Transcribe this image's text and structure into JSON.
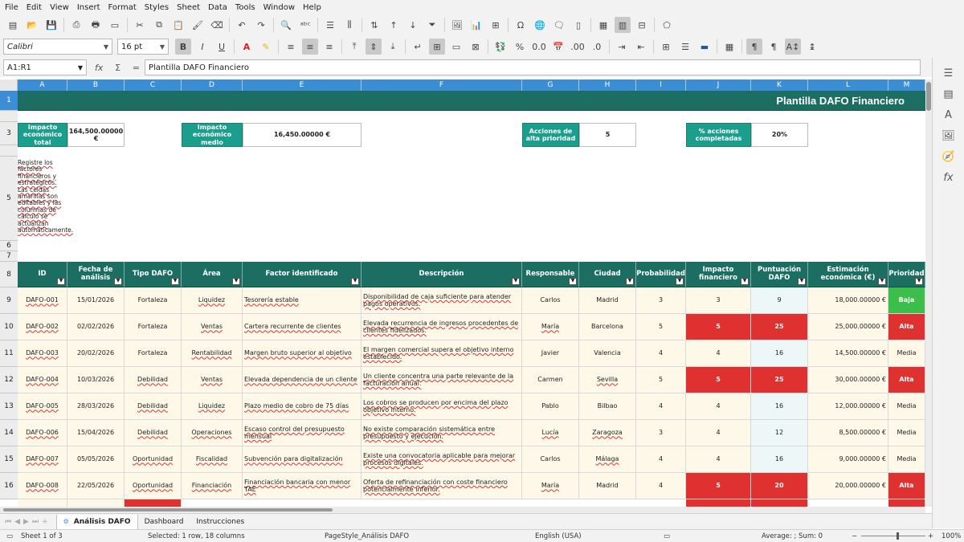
{
  "menu": [
    "File",
    "Edit",
    "View",
    "Insert",
    "Format",
    "Styles",
    "Sheet",
    "Data",
    "Tools",
    "Window",
    "Help"
  ],
  "toolbar": {
    "font_name": "Calibri",
    "font_size": "16 pt",
    "bold": "B",
    "italic": "I",
    "underline": "U"
  },
  "formula_bar": {
    "name_box": "A1:R1",
    "content": "Plantilla DAFO Financiero"
  },
  "sheet": {
    "title": "Plantilla DAFO Financiero",
    "columns": [
      "A",
      "B",
      "C",
      "D",
      "E",
      "F",
      "G",
      "H",
      "I",
      "J",
      "K",
      "L",
      "M"
    ],
    "rows_visible": [
      "1",
      "3",
      "5",
      "6",
      "7",
      "8",
      "9",
      "10",
      "11",
      "12",
      "13",
      "14",
      "15",
      "16"
    ],
    "kpis": [
      {
        "label": "Impacto económico total",
        "value": "164,500.00000 €"
      },
      {
        "label": "Impacto económico medio",
        "value": "16,450.00000 €"
      },
      {
        "label": "Acciones de alta prioridad",
        "value": "5"
      },
      {
        "label": "% acciones completadas",
        "value": "20%"
      }
    ],
    "note": "Registre los factores financieros y estratégicos. Las celdas amarillas son editables y las columnas de cálculo se actualizan automáticamente.",
    "headers": [
      "ID",
      "Fecha de análisis",
      "Tipo DAFO",
      "Área",
      "Factor identificado",
      "Descripción",
      "Responsable",
      "Ciudad",
      "Probabilidad",
      "Impacto financiero",
      "Puntuación DAFO",
      "Estimación económica (€)",
      "Prioridad"
    ],
    "rows": [
      {
        "id": "DAFO-001",
        "fecha": "15/01/2026",
        "tipo": "Fortaleza",
        "area": "Liquidez",
        "factor": "Tesorería estable",
        "desc": "Disponibilidad de caja suficiente para atender pagos operativos.",
        "resp": "Carlos",
        "ciudad": "Madrid",
        "prob": "3",
        "impacto": "3",
        "punt": "9",
        "estim": "18,000.00000 €",
        "prio": "Baja"
      },
      {
        "id": "DAFO-002",
        "fecha": "02/02/2026",
        "tipo": "Fortaleza",
        "area": "Ventas",
        "factor": "Cartera recurrente de clientes",
        "desc": "Elevada recurrencia de ingresos procedentes de clientes fidelizados.",
        "resp": "María",
        "ciudad": "Barcelona",
        "prob": "5",
        "impacto": "5",
        "punt": "25",
        "estim": "25,000.00000 €",
        "prio": "Alta"
      },
      {
        "id": "DAFO-003",
        "fecha": "20/02/2026",
        "tipo": "Fortaleza",
        "area": "Rentabilidad",
        "factor": "Margen bruto superior al objetivo",
        "desc": "El margen comercial supera el objetivo interno establecido.",
        "resp": "Javier",
        "ciudad": "Valencia",
        "prob": "4",
        "impacto": "4",
        "punt": "16",
        "estim": "14,500.00000 €",
        "prio": "Media"
      },
      {
        "id": "DAFO-004",
        "fecha": "10/03/2026",
        "tipo": "Debilidad",
        "area": "Ventas",
        "factor": "Elevada dependencia de un cliente",
        "desc": "Un cliente concentra una parte relevante de la facturación anual.",
        "resp": "Carmen",
        "ciudad": "Sevilla",
        "prob": "5",
        "impacto": "5",
        "punt": "25",
        "estim": "30,000.00000 €",
        "prio": "Alta"
      },
      {
        "id": "DAFO-005",
        "fecha": "28/03/2026",
        "tipo": "Debilidad",
        "area": "Liquidez",
        "factor": "Plazo medio de cobro de 75 días",
        "desc": "Los cobros se producen por encima del plazo objetivo interno.",
        "resp": "Pablo",
        "ciudad": "Bilbao",
        "prob": "4",
        "impacto": "4",
        "punt": "16",
        "estim": "12,000.00000 €",
        "prio": "Media"
      },
      {
        "id": "DAFO-006",
        "fecha": "15/04/2026",
        "tipo": "Debilidad",
        "area": "Operaciones",
        "factor": "Escaso control del presupuesto mensual",
        "desc": "No existe comparación sistemática entre presupuesto y ejecución.",
        "resp": "Lucía",
        "ciudad": "Zaragoza",
        "prob": "3",
        "impacto": "4",
        "punt": "12",
        "estim": "8,500.00000 €",
        "prio": "Media"
      },
      {
        "id": "DAFO-007",
        "fecha": "05/05/2026",
        "tipo": "Oportunidad",
        "area": "Fiscalidad",
        "factor": "Subvención para digitalización",
        "desc": "Existe una convocatoria aplicable para mejorar procesos digitales.",
        "resp": "Carlos",
        "ciudad": "Málaga",
        "prob": "4",
        "impacto": "4",
        "punt": "16",
        "estim": "9,000.00000 €",
        "prio": "Media"
      },
      {
        "id": "DAFO-008",
        "fecha": "22/05/2026",
        "tipo": "Oportunidad",
        "area": "Financiación",
        "factor": "Financiación bancaria con menor TAE",
        "desc": "Oferta de refinanciación con coste financiero potencialmente inferior.",
        "resp": "María",
        "ciudad": "Madrid",
        "prob": "4",
        "impacto": "5",
        "punt": "20",
        "estim": "20,000.00000 €",
        "prio": "Alta"
      }
    ]
  },
  "tabs": [
    "Análisis DAFO",
    "Dashboard",
    "Instrucciones"
  ],
  "status": {
    "sheet": "Sheet 1 of 3",
    "selection": "Selected: 1 row, 18 columns",
    "page_style": "PageStyle_Análisis DAFO",
    "language": "English (USA)",
    "sum": "Average: ; Sum: 0",
    "zoom": "100%"
  },
  "colors": {
    "header_teal": "#1c6e63",
    "kpi_teal": "#1c9e8c",
    "high_red": "#e03131",
    "low_green": "#3bbf4a",
    "selection_blue": "#3b8ed6"
  }
}
